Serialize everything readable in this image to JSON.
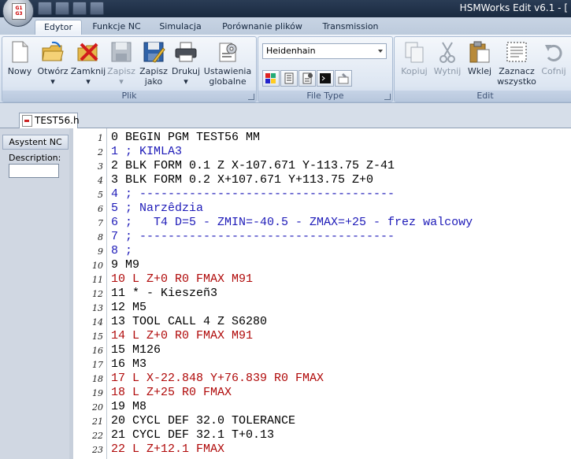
{
  "titlebar": {
    "title": "HSMWorks Edit v6.1 - ["
  },
  "ribbon_tabs": [
    {
      "label": "Edytor",
      "active": true
    },
    {
      "label": "Funkcje NC",
      "active": false
    },
    {
      "label": "Simulacja",
      "active": false
    },
    {
      "label": "Porównanie plików",
      "active": false
    },
    {
      "label": "Transmission",
      "active": false
    }
  ],
  "groups": {
    "plik": {
      "label": "Plik",
      "buttons": [
        {
          "label": "Nowy",
          "icon": "new-file-icon",
          "enabled": true
        },
        {
          "label": "Otwórz ▾",
          "icon": "open-folder-icon",
          "enabled": true
        },
        {
          "label": "Zamknij ▾",
          "icon": "close-folder-icon",
          "enabled": true
        },
        {
          "label": "Zapisz ▾",
          "icon": "save-icon",
          "enabled": false
        },
        {
          "label": "Zapisz\njako",
          "icon": "save-as-icon",
          "enabled": true
        },
        {
          "label": "Drukuj ▾",
          "icon": "printer-icon",
          "enabled": true
        },
        {
          "label": "Ustawienia\nglobalne",
          "icon": "settings-icon",
          "enabled": true
        }
      ]
    },
    "file_type": {
      "label": "File Type",
      "selected": "Heidenhain",
      "small_buttons": [
        "color-format-icon",
        "list-format-icon",
        "numbering-icon",
        "terminal-icon",
        "highlight-icon"
      ]
    },
    "edit": {
      "label": "Edit",
      "buttons": [
        {
          "label": "Kopiuj",
          "icon": "copy-icon",
          "enabled": false
        },
        {
          "label": "Wytnij",
          "icon": "scissors-icon",
          "enabled": false
        },
        {
          "label": "Wklej",
          "icon": "paste-icon",
          "enabled": true
        },
        {
          "label": "Zaznacz\nwszystko",
          "icon": "select-all-icon",
          "enabled": true
        },
        {
          "label": "Cofnij",
          "icon": "undo-icon",
          "enabled": false
        }
      ]
    }
  },
  "document_tab": {
    "label": "TEST56.h"
  },
  "side_panel": {
    "header": "Asystent NC",
    "label": "Description:",
    "value": ""
  },
  "editor": {
    "colors": {
      "black": "#000000",
      "red": "#b00a0a",
      "blue": "#1d1ab8"
    },
    "lines": [
      {
        "n": "1",
        "text": "0 BEGIN PGM TEST56 MM",
        "color": "black"
      },
      {
        "n": "2",
        "text": "1 ; KIMLA3",
        "color": "blue"
      },
      {
        "n": "3",
        "text": "2 BLK FORM 0.1 Z X-107.671 Y-113.75 Z-41",
        "color": "black"
      },
      {
        "n": "4",
        "text": "3 BLK FORM 0.2 X+107.671 Y+113.75 Z+0",
        "color": "black"
      },
      {
        "n": "5",
        "text": "4 ; ------------------------------------",
        "color": "blue"
      },
      {
        "n": "6",
        "text": "5 ; Narzêdzia",
        "color": "blue"
      },
      {
        "n": "7",
        "text": "6 ;   T4 D=5 - ZMIN=-40.5 - ZMAX=+25 - frez walcowy",
        "color": "blue"
      },
      {
        "n": "8",
        "text": "7 ; ------------------------------------",
        "color": "blue"
      },
      {
        "n": "9",
        "text": "8 ;",
        "color": "blue"
      },
      {
        "n": "10",
        "text": "9 M9",
        "color": "black"
      },
      {
        "n": "11",
        "text": "10 L Z+0 R0 FMAX M91",
        "color": "red"
      },
      {
        "n": "12",
        "text": "11 * - Kieszeñ3",
        "color": "black"
      },
      {
        "n": "13",
        "text": "12 M5",
        "color": "black"
      },
      {
        "n": "14",
        "text": "13 TOOL CALL 4 Z S6280",
        "color": "black"
      },
      {
        "n": "15",
        "text": "14 L Z+0 R0 FMAX M91",
        "color": "red"
      },
      {
        "n": "16",
        "text": "15 M126",
        "color": "black"
      },
      {
        "n": "17",
        "text": "16 M3",
        "color": "black"
      },
      {
        "n": "18",
        "text": "17 L X-22.848 Y+76.839 R0 FMAX",
        "color": "red"
      },
      {
        "n": "19",
        "text": "18 L Z+25 R0 FMAX",
        "color": "red"
      },
      {
        "n": "20",
        "text": "19 M8",
        "color": "black"
      },
      {
        "n": "21",
        "text": "20 CYCL DEF 32.0 TOLERANCE",
        "color": "black"
      },
      {
        "n": "22",
        "text": "21 CYCL DEF 32.1 T+0.13",
        "color": "black"
      },
      {
        "n": "23",
        "text": "22 L Z+12.1 FMAX",
        "color": "red"
      }
    ]
  }
}
